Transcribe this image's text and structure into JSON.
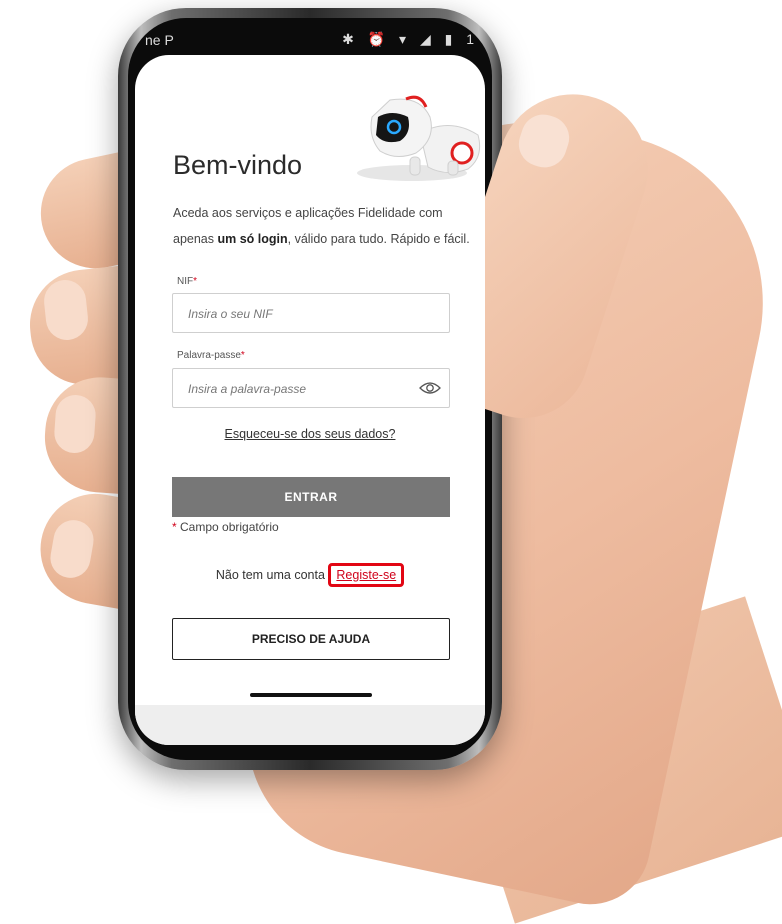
{
  "status_bar": {
    "carrier": "ne P",
    "icons": "✱ ⏰ ▾ ◢ ▮ 1"
  },
  "login": {
    "title": "Bem-vindo",
    "intro_part1": "Aceda aos serviços e aplicações Fidelidade com apenas ",
    "intro_bold": "um só login",
    "intro_part2": ", válido para tudo. Rápido e fácil.",
    "nif": {
      "label": "NIF",
      "required_mark": "*",
      "placeholder": "Insira o seu NIF"
    },
    "password": {
      "label": "Palavra-passe",
      "required_mark": "*",
      "placeholder": "Insira a palavra-passe"
    },
    "forgot_link": "Esqueceu-se dos seus dados?",
    "submit_label": "ENTRAR",
    "mandatory_mark": "*",
    "mandatory_text": " Campo obrigatório",
    "register_prompt": "Não tem uma conta ",
    "register_link": "Registe-se",
    "help_label": "PRECISO DE AJUDA"
  },
  "colors": {
    "accent_red": "#d0021b",
    "highlight_box": "#e20613",
    "submit_button": "#777777"
  },
  "icons": {
    "password_toggle": "eye-icon",
    "illustration": "robot-dog"
  }
}
